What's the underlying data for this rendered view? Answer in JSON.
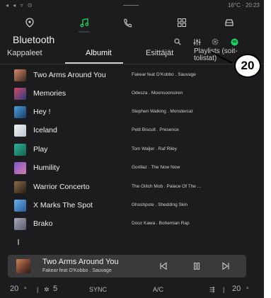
{
  "status_bar": {
    "left_icons": "◂ ◂ ▿ ⊙",
    "right_text": "16°C · 20:23"
  },
  "nav_icons": [
    "navigation-icon",
    "music-icon",
    "phone-icon",
    "apps-icon",
    "car-icon"
  ],
  "header": {
    "title": "Bluetooth"
  },
  "tabs": [
    {
      "label": "Kappaleet"
    },
    {
      "label": "Albumit"
    },
    {
      "label": "Esittäjät"
    },
    {
      "label": "Playlists (soit-\ntolistat)"
    }
  ],
  "tracks": [
    {
      "title": "Two Arms Around You",
      "artist": "Fakear feat O'Kobbo . Sauvage",
      "color_a": "#d98a6a",
      "color_b": "#3a2622"
    },
    {
      "title": "Memories",
      "artist": "Odesza . Moonsoonsiren",
      "color_a": "#d24a6a",
      "color_b": "#2d3a7a"
    },
    {
      "title": "Hey !",
      "artist": "Stephen Walking . Monstercat",
      "color_a": "#4aa0d8",
      "color_b": "#1a3a6a"
    },
    {
      "title": "Iceland",
      "artist": "Petit Biscuit . Presence",
      "color_a": "#f2f2ee",
      "color_b": "#b9c6d2"
    },
    {
      "title": "Play",
      "artist": "Tom Waljer . Raf Riley",
      "color_a": "#2fb39a",
      "color_b": "#17604f"
    },
    {
      "title": "Humility",
      "artist": "Gorillaz . The Now Now",
      "color_a": "#7a5ac8",
      "color_b": "#d77ab0"
    },
    {
      "title": "Warrior Concerto",
      "artist": "The Glitch Mob . Palace Of The ...",
      "color_a": "#8a6a4a",
      "color_b": "#2a1d14"
    },
    {
      "title": "X Marks The Spot",
      "artist": "Ghoshpote . Shedding Skin",
      "color_a": "#6ab0e8",
      "color_b": "#2a5a9a"
    },
    {
      "title": "Brako",
      "artist": "Dooz Kawa . Bohemian Rap",
      "color_a": "#a8a8b8",
      "color_b": "#5a5a6a"
    }
  ],
  "now_playing": {
    "title": "Two Arms Around You",
    "artist": "Fakear feat O'Kobbo . Sauvage"
  },
  "climate": {
    "left_temp": "20",
    "fan": "5",
    "sync": "SYNC",
    "ac": "A/C",
    "right_temp": "20"
  },
  "callout": {
    "label": "20"
  },
  "colors": {
    "background": "#1c1c1e",
    "accent_green": "#1ed760",
    "now_playing_bg": "#3a3a3c"
  }
}
